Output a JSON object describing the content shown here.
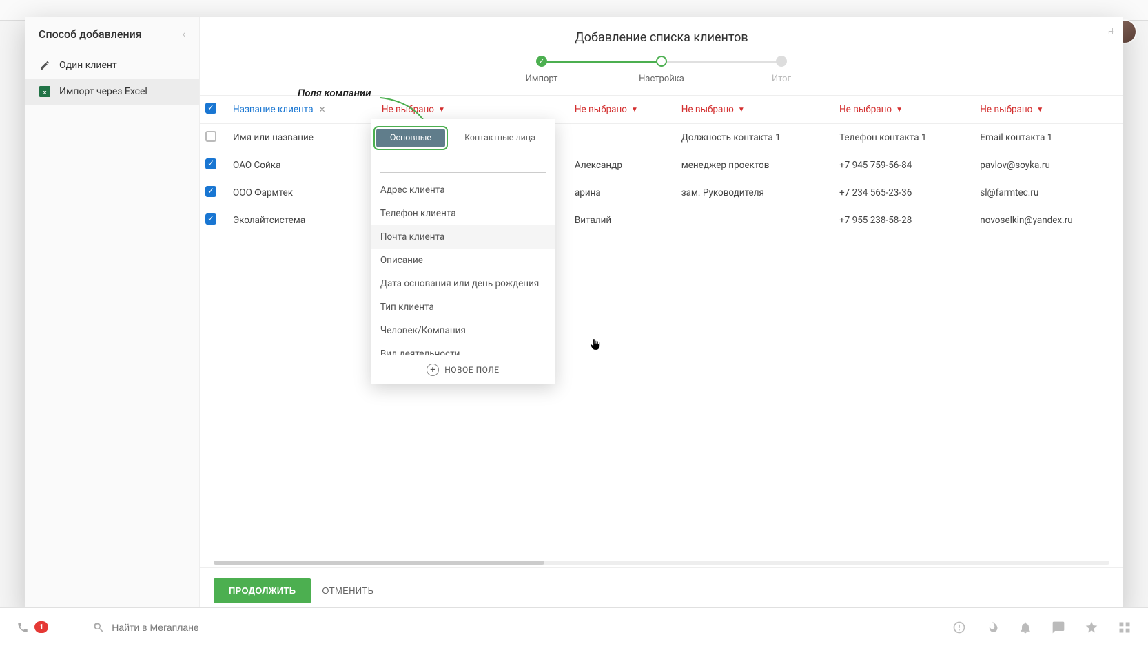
{
  "sidebar": {
    "title": "Способ добавления",
    "items": [
      {
        "label": "Один клиент",
        "active": false
      },
      {
        "label": "Импорт через Excel",
        "active": true
      }
    ]
  },
  "modal": {
    "title": "Добавление списка клиентов",
    "steps": [
      {
        "label": "Импорт",
        "state": "done"
      },
      {
        "label": "Настройка",
        "state": "current"
      },
      {
        "label": "Итог",
        "state": "pending"
      }
    ]
  },
  "annotation": "Поля компании",
  "headers": {
    "mapped": "Название клиента",
    "unmapped": "Не выбрано"
  },
  "row_header": {
    "c1": "Имя или название",
    "c4": "Должность контакта 1",
    "c5": "Телефон контакта 1",
    "c6": "Email контакта 1"
  },
  "rows": [
    {
      "checked": true,
      "c1": "ОАО Сойка",
      "c3": "Александр",
      "c4": "менеджер проектов",
      "c5": "+7 945 759-56-84",
      "c6": "pavlov@soyka.ru"
    },
    {
      "checked": true,
      "c1": "ООО Фармтек",
      "c3": "арина",
      "c4": "зам. Руководителя",
      "c5": "+7 234 565-23-36",
      "c6": "sl@farmtec.ru"
    },
    {
      "checked": true,
      "c1": "Эколайтсистема",
      "c3": "Виталий",
      "c4": "",
      "c5": "+7 955 238-58-28",
      "c6": "novoselkin@yandex.ru"
    }
  ],
  "popup": {
    "tabs": {
      "main": "Основные",
      "contacts": "Контактные лица"
    },
    "items": [
      "Адрес клиента",
      "Телефон клиента",
      "Почта клиента",
      "Описание",
      "Дата основания или день рождения",
      "Тип клиента",
      "Человек/Компания",
      "Вид деятельности"
    ],
    "new_field": "НОВОЕ ПОЛЕ"
  },
  "footer": {
    "continue": "ПРОДОЛЖИТЬ",
    "cancel": "ОТМЕНИТЬ"
  },
  "bottombar": {
    "badge": "1",
    "search_placeholder": "Найти в Мегаплане"
  }
}
